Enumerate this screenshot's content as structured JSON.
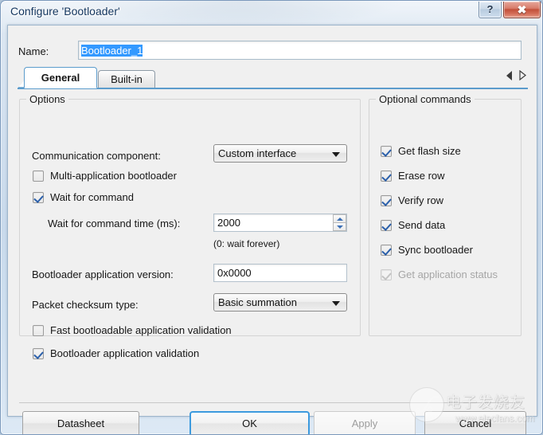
{
  "window": {
    "title": "Configure 'Bootloader'",
    "help_glyph": "?",
    "close_glyph": "✖"
  },
  "name_row": {
    "label": "Name:",
    "value": "Bootloader_1",
    "placeholder": ""
  },
  "tabs": [
    {
      "label": "General",
      "active": true
    },
    {
      "label": "Built-in",
      "active": false
    }
  ],
  "tab_nav": {
    "prev_icon": "triangle-left-icon",
    "next_icon": "triangle-right-icon"
  },
  "options_group": {
    "title": "Options",
    "communication_component": {
      "label": "Communication component:",
      "value": "Custom interface",
      "options": [
        "Custom interface"
      ]
    },
    "multi_app_bootloader": {
      "label": "Multi-application bootloader",
      "checked": false,
      "disabled": false
    },
    "wait_for_command": {
      "label": "Wait for command",
      "checked": true,
      "disabled": false
    },
    "wait_time": {
      "label": "Wait for command time (ms):",
      "value": "2000",
      "hint": "(0: wait forever)"
    },
    "bootloader_app_version": {
      "label": "Bootloader application version:",
      "value": "0x0000"
    },
    "packet_checksum_type": {
      "label": "Packet checksum type:",
      "value": "Basic summation",
      "options": [
        "Basic summation"
      ]
    },
    "fast_bootloadable_validation": {
      "label": "Fast bootloadable application validation",
      "checked": false,
      "disabled": false
    },
    "bootloader_app_validation": {
      "label": "Bootloader application validation",
      "checked": true,
      "disabled": false
    }
  },
  "optional_commands_group": {
    "title": "Optional commands",
    "items": [
      {
        "label": "Get flash size",
        "checked": true,
        "disabled": false
      },
      {
        "label": "Erase row",
        "checked": true,
        "disabled": false
      },
      {
        "label": "Verify row",
        "checked": true,
        "disabled": false
      },
      {
        "label": "Send data",
        "checked": true,
        "disabled": false
      },
      {
        "label": "Sync bootloader",
        "checked": true,
        "disabled": false
      },
      {
        "label": "Get application status",
        "checked": true,
        "disabled": true
      }
    ]
  },
  "footer": {
    "datasheet": "Datasheet",
    "ok": "OK",
    "apply": "Apply",
    "cancel": "Cancel"
  },
  "watermark": {
    "cn_text": "电子发烧友",
    "url": "www.elecfans.com",
    "logo_icon": "elecfans-circuit-logo-icon"
  },
  "colors": {
    "accent": "#3c9ade",
    "title_text": "#12355e",
    "check_mark": "#2a5faa",
    "close_button": "#c2503a",
    "tab_active_border": "#5c9ccc",
    "disabled_text": "#a6a6a6"
  }
}
